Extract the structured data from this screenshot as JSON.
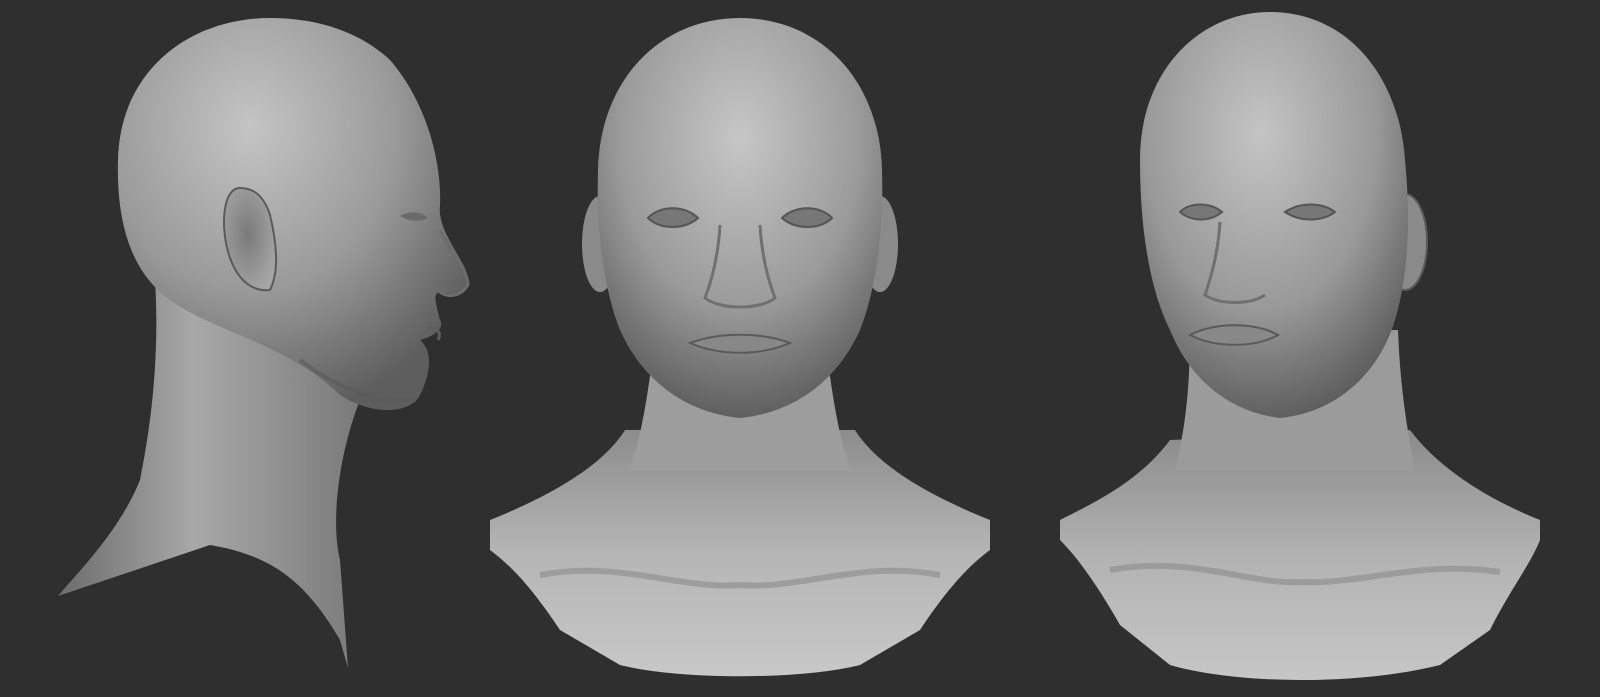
{
  "viewport": {
    "background_color": "#2f2f2f",
    "views": [
      {
        "id": "side",
        "angle": "right-profile"
      },
      {
        "id": "front",
        "angle": "front"
      },
      {
        "id": "three_quarter",
        "angle": "three-quarter-left"
      }
    ]
  },
  "colors": {
    "clay_light": "#b8b8b8",
    "clay_mid": "#8f8f8f",
    "clay_dark": "#555555",
    "shadow": "#3a3a3a"
  }
}
